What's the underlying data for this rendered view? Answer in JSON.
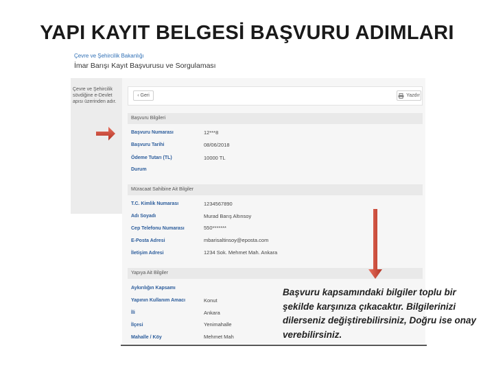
{
  "slide": {
    "title": "YAPI KAYIT BELGESİ BAŞVURU ADIMLARI"
  },
  "header": {
    "ministry": "Çevre ve Şehircilik Bakanlığı",
    "app_title": "İmar Barışı Kayıt Başvurusu ve Sorgulaması"
  },
  "sidebar": {
    "text": "Çevre ve Şehircilik sövdiğine e-Devlet apısı üzerinden adır."
  },
  "toolbar": {
    "back_label": "Geri",
    "print_label": "Yazdır"
  },
  "sections": {
    "application": {
      "title": "Başvuru Bilgileri",
      "rows": [
        {
          "label": "Başvuru Numarası",
          "value": "12***8"
        },
        {
          "label": "Başvuru Tarihi",
          "value": "08/06/2018"
        },
        {
          "label": "Ödeme Tutarı (TL)",
          "value": "10000 TL"
        },
        {
          "label": "Durum",
          "value": ""
        }
      ]
    },
    "applicant": {
      "title": "Müracaat Sahibine Ait Bilgiler",
      "rows": [
        {
          "label": "T.C. Kimlik Numarası",
          "value": "1234567890"
        },
        {
          "label": "Adı Soyadı",
          "value": "Murad Barış Altınsoy"
        },
        {
          "label": "Cep Telefonu Numarası",
          "value": "550*******"
        },
        {
          "label": "E-Posta Adresi",
          "value": "mbarisaltinsoy@eposta.com"
        },
        {
          "label": "İletişim Adresi",
          "value": "1234 Sok. Mehmet Mah. Ankara"
        }
      ]
    },
    "building": {
      "title": "Yapıya Ait Bilgiler",
      "rows": [
        {
          "label": "Aykırılığın Kapsamı",
          "value": ""
        },
        {
          "label": "Yapının Kullanım Amacı",
          "value": "Konut"
        },
        {
          "label": "İli",
          "value": "Ankara"
        },
        {
          "label": "İlçesi",
          "value": "Yenimahalle"
        },
        {
          "label": "Mahalle / Köy",
          "value": "Mehmet Mah"
        }
      ]
    }
  },
  "note": "Başvuru kapsamındaki bilgiler toplu bir şekilde karşınıza çıkacaktır. Bilgilerinizi dilerseniz değiştirebilirsiniz, Doğru ise onay verebilirsiniz.",
  "colors": {
    "arrow": "#c0392b",
    "label_blue": "#2b5c9b",
    "section_bg": "#e9e9e9"
  },
  "icons": {
    "back": "chevron-left-icon",
    "print": "printer-icon",
    "arrows": [
      "arrow-right-icon",
      "arrow-down-icon"
    ]
  }
}
